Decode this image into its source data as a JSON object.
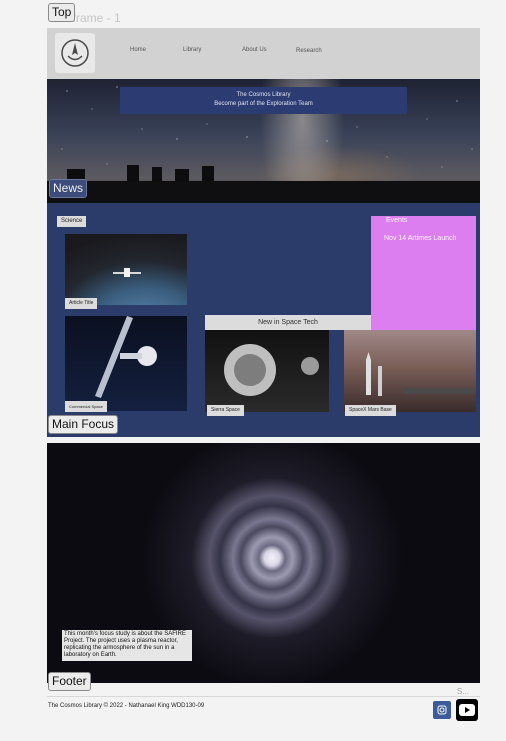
{
  "frame": {
    "title": "Wireframe - 1"
  },
  "tags": {
    "top": "Top",
    "news": "News",
    "main_focus": "Main Focus",
    "footer": "Footer"
  },
  "header": {
    "nav": [
      "Home",
      "Library",
      "About Us",
      "Research"
    ],
    "logo_icon": "rocket-emblem-icon"
  },
  "hero": {
    "line1": "The Cosmos Library",
    "line2": "Become part of the Exploration Team"
  },
  "news": {
    "science_chip": "Science",
    "article_title": "Article Title",
    "commercial_label": "Commercial Space",
    "events": {
      "title": "Events",
      "item": "Nov 14 Artimes Launch"
    },
    "tech_heading": "New in Space Tech",
    "sierra_label": "Sierra Space",
    "spacex_label": "SpaceX Mars Base"
  },
  "focus": {
    "text": "This month's focus study is about the SAFIRE Project. The project uses a plasma reactor, replicating the armosphere of the sun in a laboratory on Earth."
  },
  "footer": {
    "copyright": "The Cosmos Library © 2022 - Nathanael King WDD130-09",
    "scroll_hint": "S...",
    "icons": [
      "instagram-icon",
      "youtube-icon"
    ]
  },
  "colors": {
    "header_bg": "#d2d2d2",
    "news_bg": "#2b3b6a",
    "events_bg": "#dc7eef",
    "banner_bg": "#2c3c72"
  }
}
